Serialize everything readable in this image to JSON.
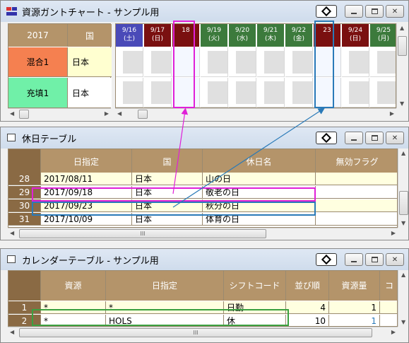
{
  "colors": {
    "pink": "#e020d8",
    "blue": "#2a7ab8",
    "green": "#3aa040",
    "mixed": "#f58050",
    "filled": "#70f0a8"
  },
  "gantt": {
    "title": "資源ガントチャート - サンプル用",
    "year_label": "2017",
    "country_header": "国",
    "rows": [
      {
        "name": "混合1",
        "country": "日本"
      },
      {
        "name": "充填1",
        "country": "日本"
      }
    ],
    "days": [
      {
        "date": "9/16",
        "dow": "(土)",
        "type": "sat"
      },
      {
        "date": "9/17",
        "dow": "(日)",
        "type": "sun"
      },
      {
        "date": "18",
        "dow": "",
        "type": "hol"
      },
      {
        "date": "9/19",
        "dow": "(火)",
        "type": "wk"
      },
      {
        "date": "9/20",
        "dow": "(水)",
        "type": "wk"
      },
      {
        "date": "9/21",
        "dow": "(木)",
        "type": "wk"
      },
      {
        "date": "9/22",
        "dow": "(金)",
        "type": "wk"
      },
      {
        "date": "23",
        "dow": "",
        "type": "hol"
      },
      {
        "date": "9/24",
        "dow": "(日)",
        "type": "sun"
      },
      {
        "date": "9/25",
        "dow": "(月)",
        "type": "wk"
      }
    ]
  },
  "holiday": {
    "title": "休日テーブル",
    "headers": [
      "日指定",
      "国",
      "休日名",
      "無効フラグ"
    ],
    "rows": [
      {
        "no": "28",
        "date": "2017/08/11",
        "country": "日本",
        "name": "山の日"
      },
      {
        "no": "29",
        "date": "2017/09/18",
        "country": "日本",
        "name": "敬老の日"
      },
      {
        "no": "30",
        "date": "2017/09/23",
        "country": "日本",
        "name": "秋分の日"
      },
      {
        "no": "31",
        "date": "2017/10/09",
        "country": "日本",
        "name": "体育の日"
      }
    ]
  },
  "calendar": {
    "title": "カレンダーテーブル - サンプル用",
    "headers": [
      "資源",
      "日指定",
      "シフトコード",
      "並び順",
      "資源量",
      "コ"
    ],
    "rows": [
      {
        "no": "1",
        "resource": "*",
        "date": "*",
        "shift": "日勤",
        "order": "4",
        "qty": "1"
      },
      {
        "no": "2",
        "resource": "*",
        "date": "HOLS",
        "shift": "休",
        "order": "10",
        "qty": "1"
      }
    ]
  },
  "scroll_glyph": "III"
}
